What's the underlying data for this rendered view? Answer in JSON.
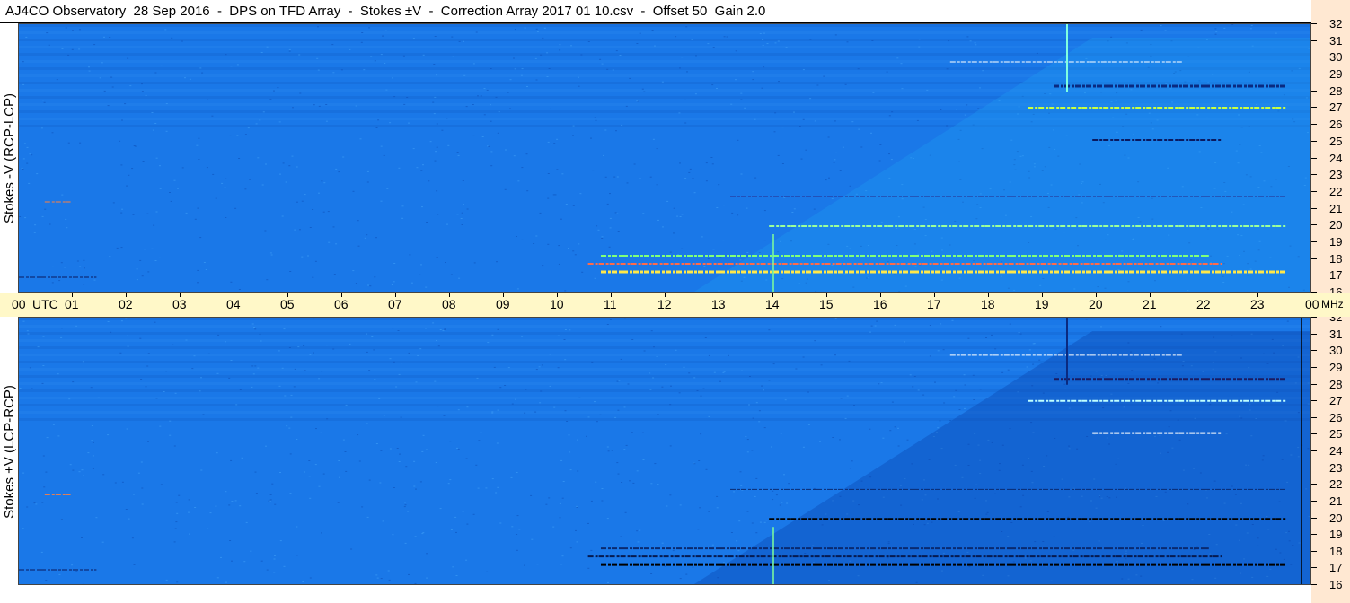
{
  "title": "AJ4CO Observatory  28 Sep 2016  -  DPS on TFD Array  -  Stokes ±V  -  Correction Array 2017 01 10.csv  -  Offset 50  Gain 2.0",
  "panels": {
    "top_label": "Stokes -V (RCP-LCP)",
    "bottom_label": "Stokes +V (LCP-RCP)"
  },
  "time_axis": {
    "start_label": "00",
    "unit_label": "UTC",
    "end_label": "00",
    "freq_unit": "MHz",
    "hours": [
      "01",
      "02",
      "03",
      "04",
      "05",
      "06",
      "07",
      "08",
      "09",
      "10",
      "11",
      "12",
      "13",
      "14",
      "15",
      "16",
      "17",
      "18",
      "19",
      "20",
      "21",
      "22",
      "23"
    ]
  },
  "colors": {
    "background_blue": "#1a78e8",
    "freq_axis_bg": "#ffe8d2",
    "time_axis_bg": "#fff8c8"
  },
  "chart_data": [
    {
      "type": "heatmap",
      "title": "Stokes -V (RCP-LCP)",
      "xlabel": "UTC",
      "ylabel": "MHz",
      "x_range": [
        0,
        24
      ],
      "y_range": [
        16,
        32
      ],
      "y_ticks": [
        16,
        17,
        18,
        19,
        20,
        21,
        22,
        23,
        24,
        25,
        26,
        27,
        28,
        29,
        30,
        31,
        32
      ]
    },
    {
      "type": "heatmap",
      "title": "Stokes +V (LCP-RCP)",
      "xlabel": "UTC",
      "ylabel": "MHz",
      "x_range": [
        0,
        24
      ],
      "y_range": [
        16,
        32
      ],
      "y_ticks": [
        16,
        17,
        18,
        19,
        20,
        21,
        22,
        23,
        24,
        25,
        26,
        27,
        28,
        29,
        30,
        31,
        32
      ]
    }
  ]
}
